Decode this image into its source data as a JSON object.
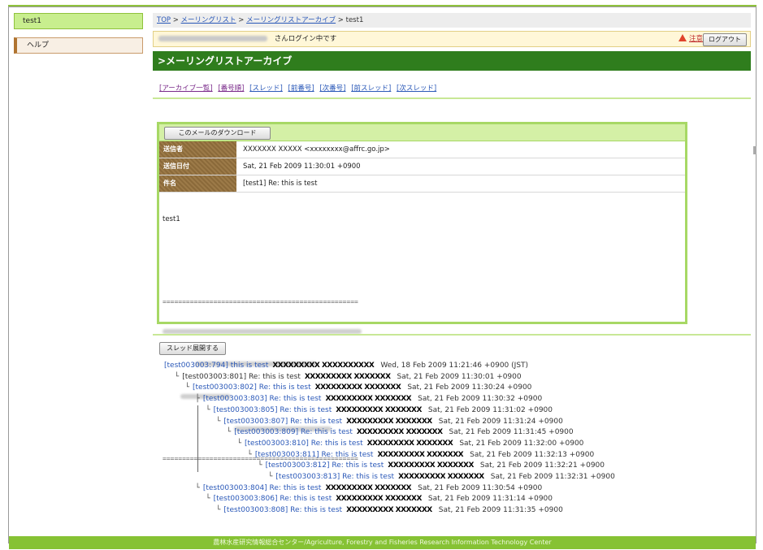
{
  "sidebar": {
    "current_list": "test1",
    "help_label": "ヘルプ"
  },
  "breadcrumb": {
    "top": "TOP",
    "sep": " > ",
    "mailing_list": "メーリングリスト",
    "archive": "メーリングリストアーカイブ",
    "current": "test1"
  },
  "login_bar": {
    "suffix": "さんログイン中です",
    "warning_label": "注意",
    "logout_label": "ログアウト"
  },
  "page_title": ">メーリングリストアーカイブ",
  "nav_links": [
    "[アーカイブ一覧]",
    "[番号順]",
    "[スレッド]",
    "[前番号]",
    "[次番号]",
    "[前スレッド]",
    "[次スレッド]"
  ],
  "message": {
    "download_label": "このメールのダウンロード",
    "sender_label": "送信者",
    "sender_value": "XXXXXXX XXXXX <xxxxxxxx@affrc.go.jp>",
    "date_label": "送信日付",
    "date_value": "Sat, 21 Feb 2009 11:30:01 +0900",
    "subject_label": "件名",
    "subject_value": "[test1] Re: this is test",
    "body_first_line": "test1",
    "separator": "=================================================="
  },
  "thread": {
    "expand_label": "スレッド展開する",
    "items": [
      {
        "tree": "",
        "link": "[test003003:794] this is test",
        "author": "XXXXXXXXX XXXXXXXXXX",
        "date": "Wed, 18 Feb 2009 11:21:46 +0900 (JST)",
        "is_link": true
      },
      {
        "tree": "└",
        "link": "[test003003:801] Re: this is test",
        "author": "XXXXXXXXX XXXXXXX",
        "date": "Sat, 21 Feb 2009 11:30:01 +0900",
        "is_link": false
      },
      {
        "tree": "└",
        "link": "[test003003:802] Re: this is test",
        "author": "XXXXXXXXX XXXXXXX",
        "date": "Sat, 21 Feb 2009 11:30:24 +0900",
        "is_link": true
      },
      {
        "tree": "├",
        "link": "[test003003:803] Re: this is test",
        "author": "XXXXXXXXX XXXXXXX",
        "date": "Sat, 21 Feb 2009 11:30:32 +0900",
        "is_link": true
      },
      {
        "tree": "└",
        "link": "[test003003:805] Re: this is test",
        "author": "XXXXXXXXX XXXXXXX",
        "date": "Sat, 21 Feb 2009 11:31:02 +0900",
        "is_link": true
      },
      {
        "tree": "└",
        "link": "[test003003:807] Re: this is test",
        "author": "XXXXXXXXX XXXXXXX",
        "date": "Sat, 21 Feb 2009 11:31:24 +0900",
        "is_link": true
      },
      {
        "tree": "└",
        "link": "[test003003:809] Re: this is test",
        "author": "XXXXXXXXX XXXXXXX",
        "date": "Sat, 21 Feb 2009 11:31:45 +0900",
        "is_link": true
      },
      {
        "tree": "└",
        "link": "[test003003:810] Re: this is test",
        "author": "XXXXXXXXX XXXXXXX",
        "date": "Sat, 21 Feb 2009 11:32:00 +0900",
        "is_link": true
      },
      {
        "tree": "└",
        "link": "[test003003:811] Re: this is test",
        "author": "XXXXXXXXX XXXXXXX",
        "date": "Sat, 21 Feb 2009 11:32:13 +0900",
        "is_link": true
      },
      {
        "tree": "└",
        "link": "[test003003:812] Re: this is test",
        "author": "XXXXXXXXX XXXXXXX",
        "date": "Sat, 21 Feb 2009 11:32:21 +0900",
        "is_link": true
      },
      {
        "tree": "└",
        "link": "[test003003:813] Re: this is test",
        "author": "XXXXXXXXX XXXXXXX",
        "date": "Sat, 21 Feb 2009 11:32:31 +0900",
        "is_link": true
      },
      {
        "tree": "└",
        "link": "[test003003:804] Re: this is test",
        "author": "XXXXXXXXX XXXXXXX",
        "date": "Sat, 21 Feb 2009 11:30:54 +0900",
        "is_link": true
      },
      {
        "tree": "└",
        "link": "[test003003:806] Re: this is test",
        "author": "XXXXXXXXX XXXXXXX",
        "date": "Sat, 21 Feb 2009 11:31:14 +0900",
        "is_link": true
      },
      {
        "tree": "└",
        "link": "[test003003:808] Re: this is test",
        "author": "XXXXXXXXX XXXXXXX",
        "date": "Sat, 21 Feb 2009 11:31:35 +0900",
        "is_link": true
      }
    ]
  },
  "footer": "農林水産研究情報総合センター/Agriculture, Forestry and Fisheries Research Information Technology Center",
  "colors": {
    "header_green": "#2f7d1d",
    "footer_green": "#86c234",
    "link_blue": "#2a58b8",
    "warning_red": "#c03030"
  }
}
